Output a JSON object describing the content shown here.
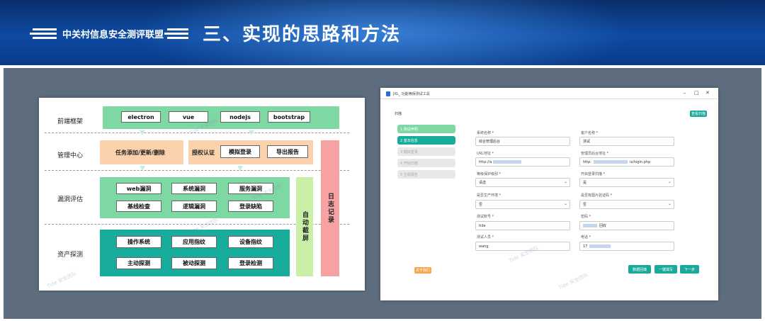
{
  "header": {
    "org_name": "中关村信息安全测评联盟",
    "slide_title": "三、实现的思路和方法"
  },
  "architecture": {
    "rows": [
      {
        "label": "前端框架",
        "items": [
          "electron",
          "vue",
          "nodejs",
          "bootstrap"
        ]
      },
      {
        "label": "管理中心",
        "items": [
          "任务添加/更新/删除",
          "授权认证",
          "模拟登录",
          "导出报告"
        ]
      },
      {
        "label": "漏洞评估",
        "items": [
          "web漏洞",
          "系统漏洞",
          "服务漏洞",
          "基线检查",
          "逻辑漏洞",
          "登录缺陷"
        ]
      },
      {
        "label": "资产探测",
        "items": [
          "操作系统",
          "应用指纹",
          "设备指纹",
          "主动探测",
          "被动探测",
          "登录检测"
        ]
      }
    ],
    "side_bars": {
      "auto_screenshot": "自动截屏",
      "log": "日志记录"
    },
    "colors": {
      "green": "#7ed8a3",
      "orange": "#fcd2ad",
      "teal": "#18ac9c",
      "lightgreen": "#c9f0a6",
      "pink": "#f6a2a2",
      "arrow": "#c9ebe2"
    }
  },
  "app": {
    "window_title": "JXL_ 功能等保测试工具",
    "window_controls": [
      "–",
      "□",
      "✕"
    ],
    "section": "扫描",
    "top_button": "查看扫描",
    "steps": [
      "1 测试声明",
      "2 基本信息",
      "3 模拟登录",
      "4 开始扫描",
      "5 生成报告"
    ],
    "fields": [
      {
        "label": "系统名称 *",
        "value": "综合管理后台"
      },
      {
        "label": "客户名称 *",
        "value": "测试"
      },
      {
        "label": "URL地址 *",
        "value": "http://a"
      },
      {
        "label": "管理员后台地址 *",
        "value": "http:",
        "suffix": "ix/login.php"
      },
      {
        "label": "等级保护级别 *",
        "value": "请选"
      },
      {
        "label": "开启登录扫描 *",
        "value": "是"
      },
      {
        "label": "是否生产环境 *",
        "value": "否"
      },
      {
        "label": "是否有图片验证码 *",
        "value": "否"
      },
      {
        "label": "测试账号 *",
        "value": "tide"
      },
      {
        "label": "密码 *",
        "value": "回收"
      },
      {
        "label": "测试人员 *",
        "value": "wang"
      },
      {
        "label": "电话 *",
        "value": "17"
      }
    ],
    "bottom_left_button": "关于我们",
    "buttons": [
      "数据回填",
      "一键填写",
      "下一步"
    ],
    "watermark": "Tide 安全团队"
  }
}
